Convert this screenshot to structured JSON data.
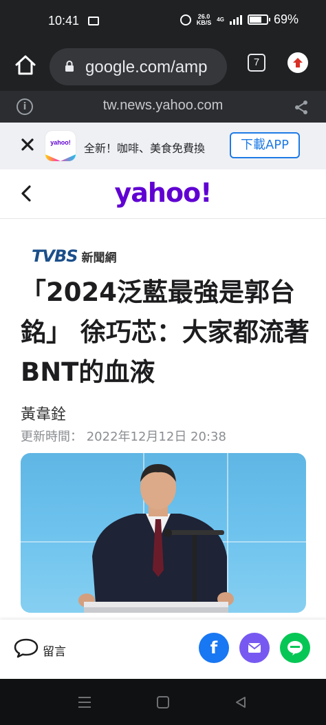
{
  "status_bar": {
    "time": "10:41",
    "net_speed_value": "26.0",
    "net_speed_unit": "KB/S",
    "network": "4G",
    "battery": "69%"
  },
  "browser": {
    "url": "google.com/amp",
    "tab_count": "7",
    "origin_domain": "tw.news.yahoo.com"
  },
  "app_banner": {
    "logo_text": "yahoo!",
    "promo_text": "全新！咖啡、美食免費換",
    "download_label": "下載APP"
  },
  "site_header": {
    "logo_text": "yahoo!"
  },
  "article": {
    "source_logo": "TVBS",
    "source_name": "新聞網",
    "headline": "「2024泛藍最強是郭台銘」 徐巧芯：大家都流著BNT的血液",
    "author": "黃韋銓",
    "updated": "更新時間： 2022年12月12日 20:38"
  },
  "action_bar": {
    "comment_label": "留言",
    "facebook_glyph": "f",
    "icons": [
      "comment-icon",
      "facebook-icon",
      "mail-icon",
      "line-icon"
    ]
  },
  "colors": {
    "yahoo_purple": "#6001d2",
    "facebook": "#1877f2",
    "mail": "#7759f1",
    "line": "#06c755",
    "download_blue": "#1d7ae5"
  }
}
